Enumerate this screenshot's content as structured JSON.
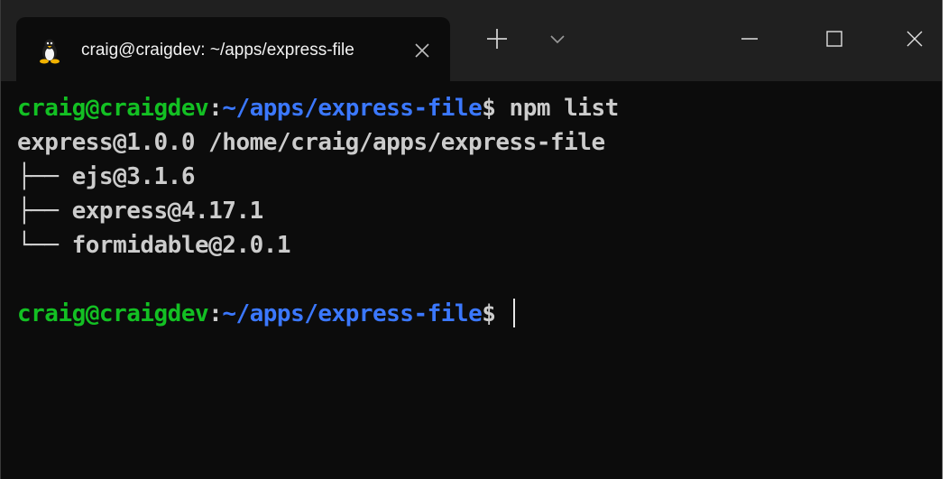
{
  "tab": {
    "title": "craig@craigdev: ~/apps/express-file",
    "icon": "linux-penguin-icon"
  },
  "titlebar": {
    "new_tab_icon": "plus-icon",
    "dropdown_icon": "chevron-down-icon",
    "minimize_icon": "minimize-icon",
    "maximize_icon": "maximize-icon",
    "close_icon": "close-icon"
  },
  "colors": {
    "background": "#0c0c0c",
    "titlebar": "#202020",
    "user_host": "#13c023",
    "path": "#3b78ff",
    "text": "#cccccc"
  },
  "terminal": {
    "prompt_user_host": "craig@craigdev",
    "prompt_colon": ":",
    "prompt_path": "~/apps/express-file",
    "prompt_symbol": "$",
    "command": " npm list",
    "output": [
      "express@1.0.0 /home/craig/apps/express-file",
      "├── ejs@3.1.6",
      "├── express@4.17.1",
      "└── formidable@2.0.1"
    ],
    "prompt2_symbol": "$ "
  }
}
